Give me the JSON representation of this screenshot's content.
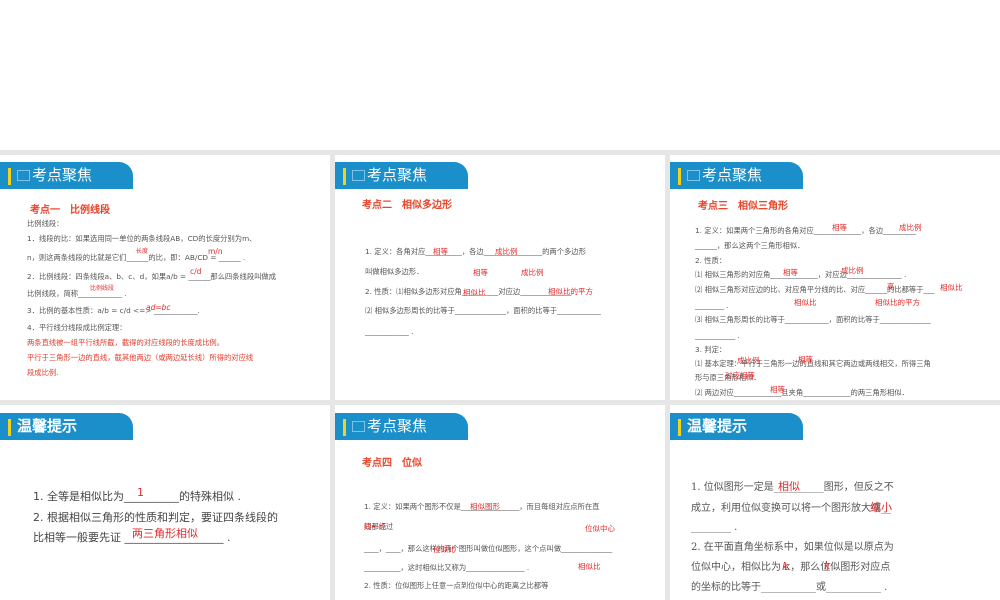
{
  "slides": [
    {
      "header": "考点聚焦",
      "subtitle": "考点一　比例线段",
      "lines": [
        "比例线段：",
        "1．线段的比：如果选用同一单位的两条线段AB，CD的长度分别为m、",
        "n，则这两条线段的比就是它们______的比，即：AB/CD = ______ .",
        "2．比例线段：四条线段a、b、c、d，如果a/b = ______那么四条线段叫做成",
        "比例线段，简称____________ .",
        "3．比例的基本性质：a/b = c/d <=> ____________.",
        "4．平行线分线段成比例定理："
      ],
      "red_lines": [
        "两条直线被一组平行线所截，截得的对应线段的长度成比例。",
        "平行于三角形一边的直线，截其他两边（或两边延长线）所得的对应线",
        "段成比例."
      ],
      "answers": [
        "长度",
        "m/n",
        "c/d",
        "比例线段",
        "ad=bc"
      ]
    },
    {
      "header": "考点聚焦",
      "subtitle": "考点二　相似多边形",
      "lines": [
        "1. 定义：各角对应__________，各边________________的两个多边形",
        "叫做相似多边形．",
        "2. 性质：⑴相似多边形对应角__________对应边______________.",
        "⑵ 相似多边形周长的比等于______________，面积的比等于____________",
        "____________ ."
      ],
      "answers": [
        "相等",
        "成比例",
        "相等",
        "成比例",
        "相似比",
        "相似比的平方"
      ]
    },
    {
      "header": "考点聚焦",
      "subtitle": "考点三　相似三角形",
      "lines": [
        "1. 定义：如果两个三角形的各角对应_____________，各边_________",
        "______，那么这两个三角形相似．",
        "2. 性质：",
        "⑴ 相似三角形的对应角_____________，对应边_______________ .",
        "⑵ 相似三角形对应边的比、对应角平分线的比、对应______的比都等于___",
        "________ .",
        "⑶ 相似三角形周长的比等于____________，面积的比等于______________",
        "___________ .",
        "3. 判定：",
        "⑴ 基本定理：平行于三角形一边的直线和其它两边或两线相交，所得三角",
        "形与原三角形相似．",
        "⑵ 两边对应_____________且夹角_____________的两三角形相似．"
      ],
      "answers": [
        "相等",
        "成比例",
        "相等",
        "成比例",
        "高",
        "相似比",
        "相似比",
        "相似比的平方",
        "成比例",
        "相等",
        "对应相等",
        "相等"
      ]
    },
    {
      "header": "温馨提示",
      "subtitle": "",
      "lines": [
        "1. 全等是相似比为__________的特殊相似 .",
        "2. 根据相似三角形的性质和判定，要证四条线段的",
        "比相等一般要先证 __________________ ."
      ],
      "answers": [
        "1",
        "两三角形相似"
      ]
    },
    {
      "header": "考点聚焦",
      "subtitle": "考点四　位似",
      "lines": [
        "1. 定义：如果两个图形不仅是________________，而且每组对应点所在直",
        "线都经过",
        "____，____，那么这样的两个图形叫做位似图形，这个点叫做______________",
        "__________，这时相似比又称为________________ .",
        "2. 性质：位似图形上任意一点到位似中心的距离之比都等"
      ],
      "answers": [
        "相似图形",
        "同一点",
        "位似中心",
        "位似比",
        "相似比"
      ]
    },
    {
      "header": "温馨提示",
      "subtitle": "",
      "lines": [
        "1. 位似图形一定是__________图形，但反之不",
        "成立，利用位似变换可以将一个图形放大或__",
        "________ .",
        "2. 在平面直角坐标系中，如果位似是以原点为",
        "位似中心，相似比为 k，那么位似图形对应点",
        "的坐标的比等于___________或___________ ."
      ],
      "answers": [
        "相似",
        "缩小",
        "k",
        "k"
      ]
    }
  ]
}
